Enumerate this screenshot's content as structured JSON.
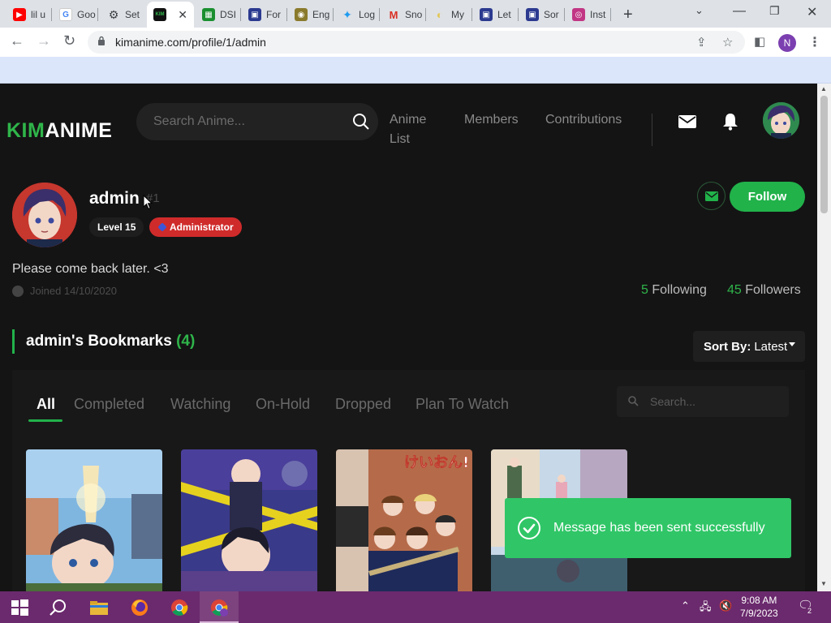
{
  "browser": {
    "tabs": [
      {
        "title": "lil u",
        "color": "#ff0000",
        "glyph": "▶"
      },
      {
        "title": "Goo",
        "color": "#4285f4",
        "glyph": "G"
      },
      {
        "title": "Set",
        "color": "#3c4043",
        "glyph": "⚙"
      },
      {
        "title": "",
        "color": "#111111",
        "glyph": "KIM",
        "active": true
      },
      {
        "title": "DSI",
        "color": "#1a8f2f",
        "glyph": "▦"
      },
      {
        "title": "For",
        "color": "#2b3a8f",
        "glyph": "▣"
      },
      {
        "title": "Eng",
        "color": "#8a7a2c",
        "glyph": "◉"
      },
      {
        "title": "Log",
        "color": "#1d9bf0",
        "glyph": "✦"
      },
      {
        "title": "Sno",
        "color": "#d93025",
        "glyph": "M"
      },
      {
        "title": "My",
        "color": "#e3c85a",
        "glyph": "◐"
      },
      {
        "title": "Let",
        "color": "#2b3a8f",
        "glyph": "▣"
      },
      {
        "title": "Sor",
        "color": "#2b3a8f",
        "glyph": "▣"
      },
      {
        "title": "Inst",
        "color": "#c13584",
        "glyph": "◎"
      }
    ],
    "new_tab": "+",
    "url": "kimanime.com/profile/1/admin",
    "profile_initial": "N"
  },
  "site": {
    "logo_kim": "KIM",
    "logo_anime": "ANIME",
    "search_placeholder": "Search Anime...",
    "nav": {
      "anime_list_line1": "Anime",
      "anime_list_line2": "List",
      "members": "Members",
      "contributions": "Contributions"
    },
    "colors": {
      "accent": "#21b24a",
      "admin_badge": "#d02b2b",
      "toast": "#30c667"
    }
  },
  "profile": {
    "username": "admin",
    "user_id": "#1",
    "level": "Level 15",
    "role": "Administrator",
    "bio": "Please come back later. <3",
    "joined": "Joined 14/10/2020",
    "follow_button": "Follow",
    "following_count": "5",
    "following_label": "Following",
    "followers_count": "45",
    "followers_label": "Followers"
  },
  "bookmarks": {
    "title": "admin's Bookmarks",
    "count": "(4)",
    "sort_label": "Sort By:",
    "sort_value": "Latest",
    "tabs": [
      "All",
      "Completed",
      "Watching",
      "On-Hold",
      "Dropped",
      "Plan To Watch"
    ],
    "active_tab": "All",
    "search_placeholder": "Search...",
    "cards": [
      {
        "name": "detective-conan-poster-1"
      },
      {
        "name": "detective-conan-poster-2"
      },
      {
        "name": "k-on-poster",
        "title_art": "けいおん!"
      },
      {
        "name": "spy-family-poster"
      }
    ]
  },
  "toast": {
    "message": "Message has been sent successfully"
  },
  "taskbar": {
    "time": "9:08 AM",
    "date": "7/9/2023",
    "notifications": "2"
  }
}
